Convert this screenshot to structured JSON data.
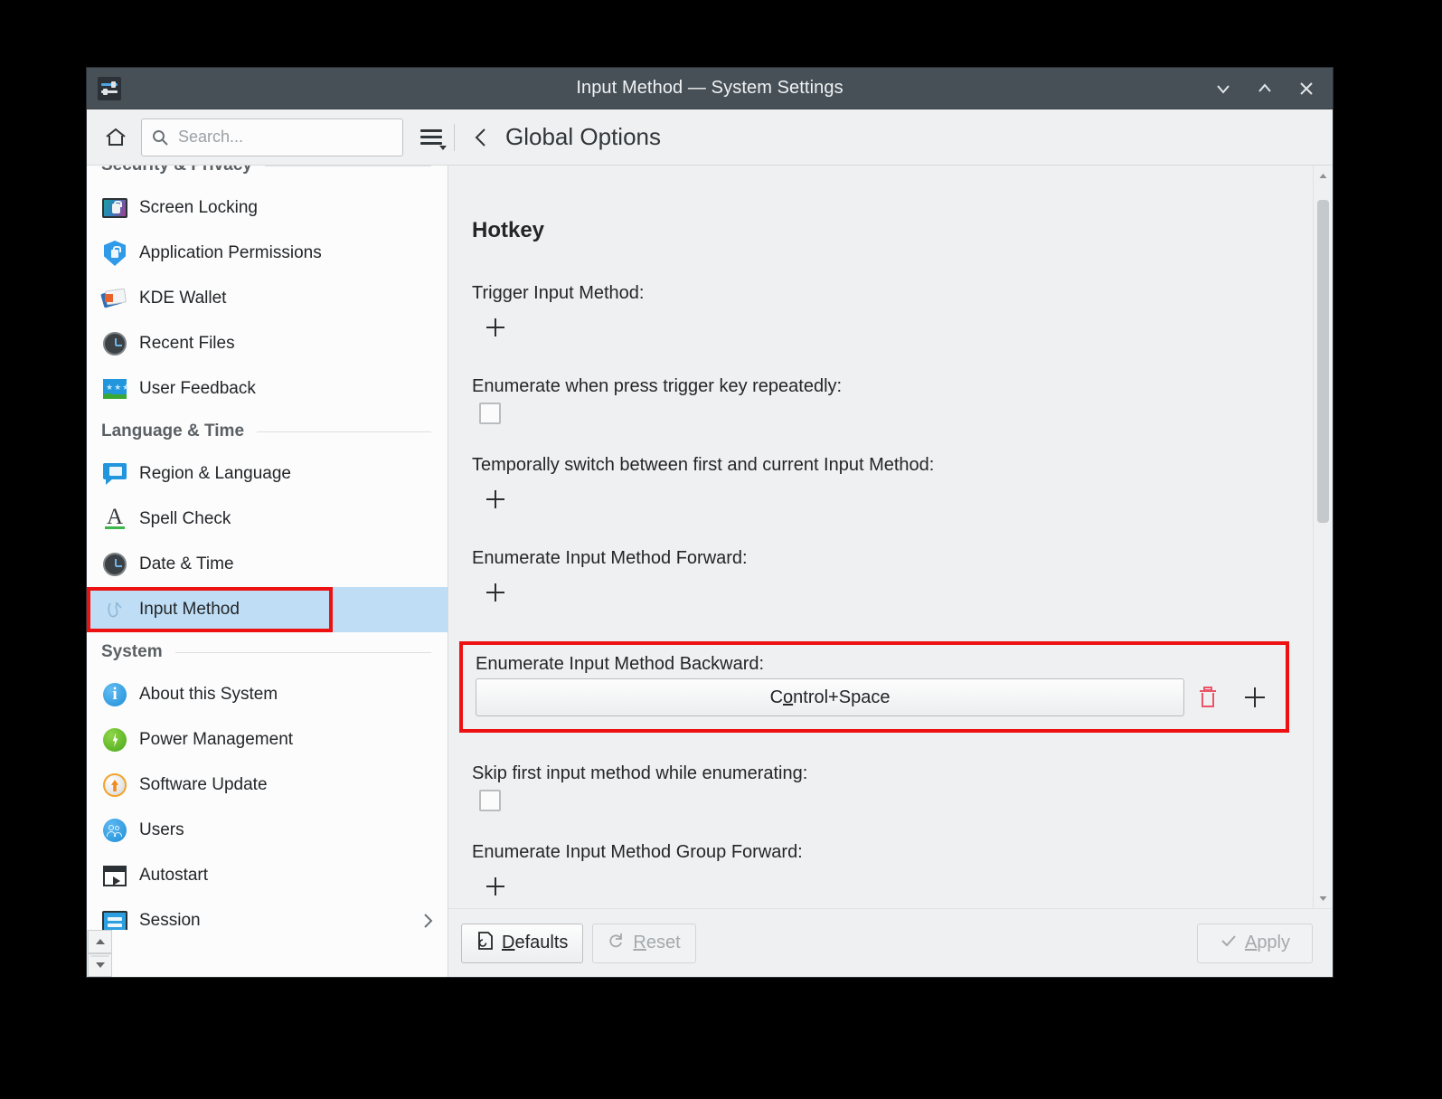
{
  "window": {
    "title": "Input Method — System Settings",
    "app_icon": "settings-sliders-icon",
    "minimize_label": "Minimize",
    "maximize_label": "Maximize",
    "close_label": "Close"
  },
  "toolbar": {
    "home_label": "Home",
    "search_placeholder": "Search...",
    "search_value": "",
    "menu_label": "Menu",
    "back_label": "Back",
    "page_title": "Global Options"
  },
  "sidebar": {
    "groups": [
      {
        "title": "Security & Privacy",
        "items": [
          {
            "label": "Screen Locking",
            "icon": "screen-locking-icon"
          },
          {
            "label": "Application Permissions",
            "icon": "shield-lock-icon"
          },
          {
            "label": "KDE Wallet",
            "icon": "wallet-icon"
          },
          {
            "label": "Recent Files",
            "icon": "clock-icon"
          },
          {
            "label": "User Feedback",
            "icon": "feedback-icon"
          }
        ]
      },
      {
        "title": "Language & Time",
        "items": [
          {
            "label": "Region & Language",
            "icon": "region-language-icon"
          },
          {
            "label": "Spell Check",
            "icon": "spell-check-icon"
          },
          {
            "label": "Date & Time",
            "icon": "clock-icon"
          },
          {
            "label": "Input Method",
            "icon": "input-method-icon",
            "selected": true
          }
        ]
      },
      {
        "title": "System",
        "items": [
          {
            "label": "About this System",
            "icon": "info-icon"
          },
          {
            "label": "Power Management",
            "icon": "power-icon"
          },
          {
            "label": "Software Update",
            "icon": "software-update-icon"
          },
          {
            "label": "Users",
            "icon": "users-icon"
          },
          {
            "label": "Autostart",
            "icon": "autostart-icon"
          },
          {
            "label": "Session",
            "icon": "session-icon",
            "chevron": true
          }
        ]
      }
    ]
  },
  "main": {
    "section_title": "Hotkey",
    "fields": [
      {
        "label": "Trigger Input Method:",
        "control": "add"
      },
      {
        "label": "Enumerate when press trigger key repeatedly:",
        "control": "checkbox",
        "checked": false
      },
      {
        "label": "Temporally switch between first and current Input Method:",
        "control": "add"
      },
      {
        "label": "Enumerate Input Method Forward:",
        "control": "add"
      },
      {
        "label": "Enumerate Input Method Backward:",
        "control": "hotkey",
        "value": "Control+Space",
        "highlighted": true
      },
      {
        "label": "Skip first input method while enumerating:",
        "control": "checkbox",
        "checked": false
      },
      {
        "label": "Enumerate Input Method Group Forward:",
        "control": "add"
      }
    ]
  },
  "footer": {
    "defaults_label": "Defaults",
    "reset_label": "Reset",
    "apply_label": "Apply",
    "reset_disabled": true,
    "apply_disabled": true
  },
  "colors": {
    "titlebar": "#475057",
    "window_bg": "#eff0f1",
    "selection": "#bfdef5",
    "annotation": "#ee1111",
    "trash": "#e9566a",
    "accent_link": "#2980b9"
  }
}
